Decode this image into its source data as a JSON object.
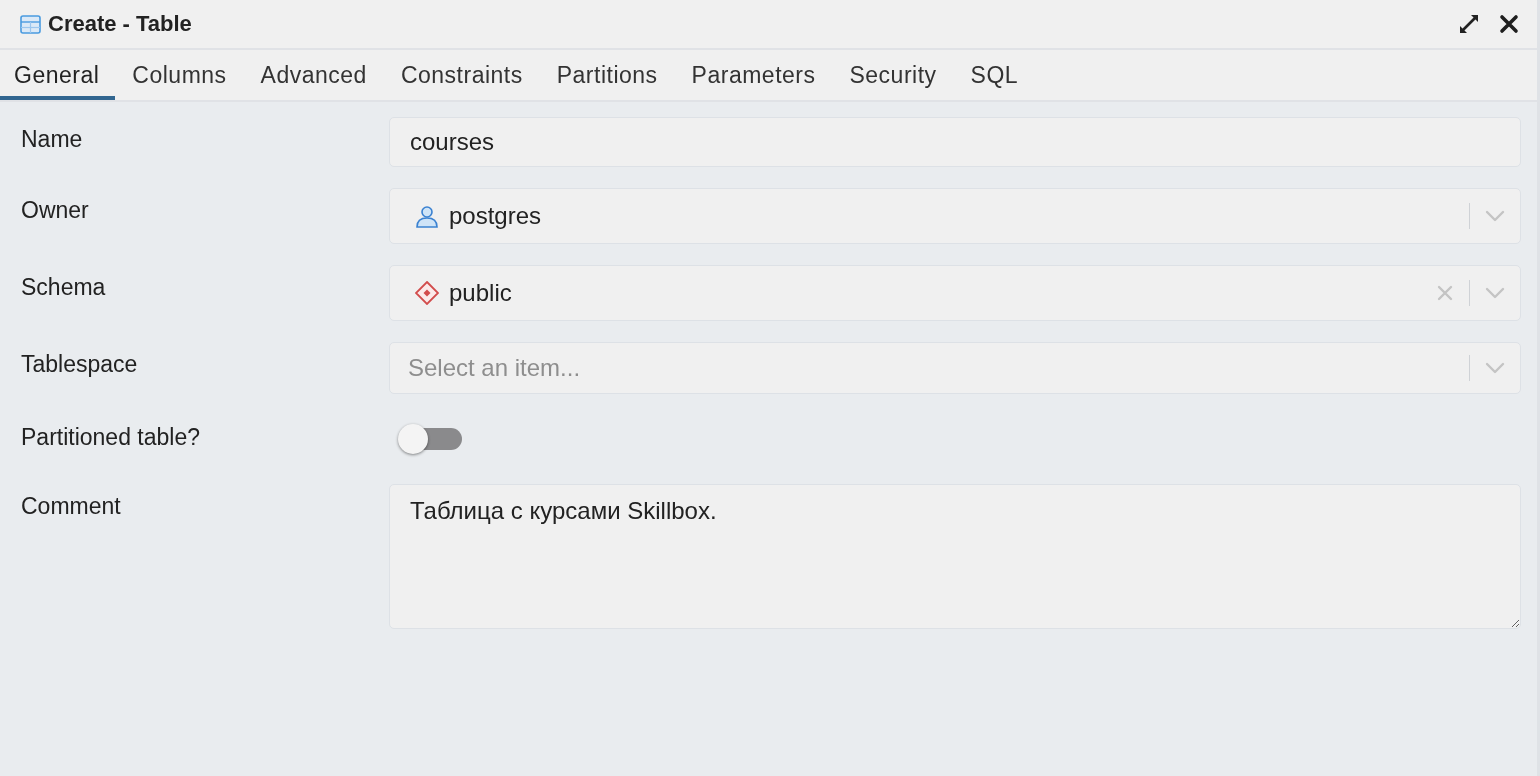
{
  "window": {
    "title": "Create - Table"
  },
  "tabs": [
    {
      "label": "General",
      "selected": true
    },
    {
      "label": "Columns",
      "selected": false
    },
    {
      "label": "Advanced",
      "selected": false
    },
    {
      "label": "Constraints",
      "selected": false
    },
    {
      "label": "Partitions",
      "selected": false
    },
    {
      "label": "Parameters",
      "selected": false
    },
    {
      "label": "Security",
      "selected": false
    },
    {
      "label": "SQL",
      "selected": false
    }
  ],
  "fields": [
    {
      "label": "Name",
      "kind": "text",
      "value": "courses"
    },
    {
      "label": "Owner",
      "kind": "role",
      "value": "postgres",
      "clearable": false
    },
    {
      "label": "Schema",
      "kind": "schema",
      "value": "public",
      "clearable": true
    },
    {
      "label": "Tablespace",
      "kind": "select",
      "placeholder": "Select an item...",
      "clearable": false
    },
    {
      "label": "Partitioned table?",
      "kind": "switch",
      "on": false
    },
    {
      "label": "Comment",
      "kind": "textarea",
      "value": "Таблица с курсами Skillbox."
    }
  ]
}
